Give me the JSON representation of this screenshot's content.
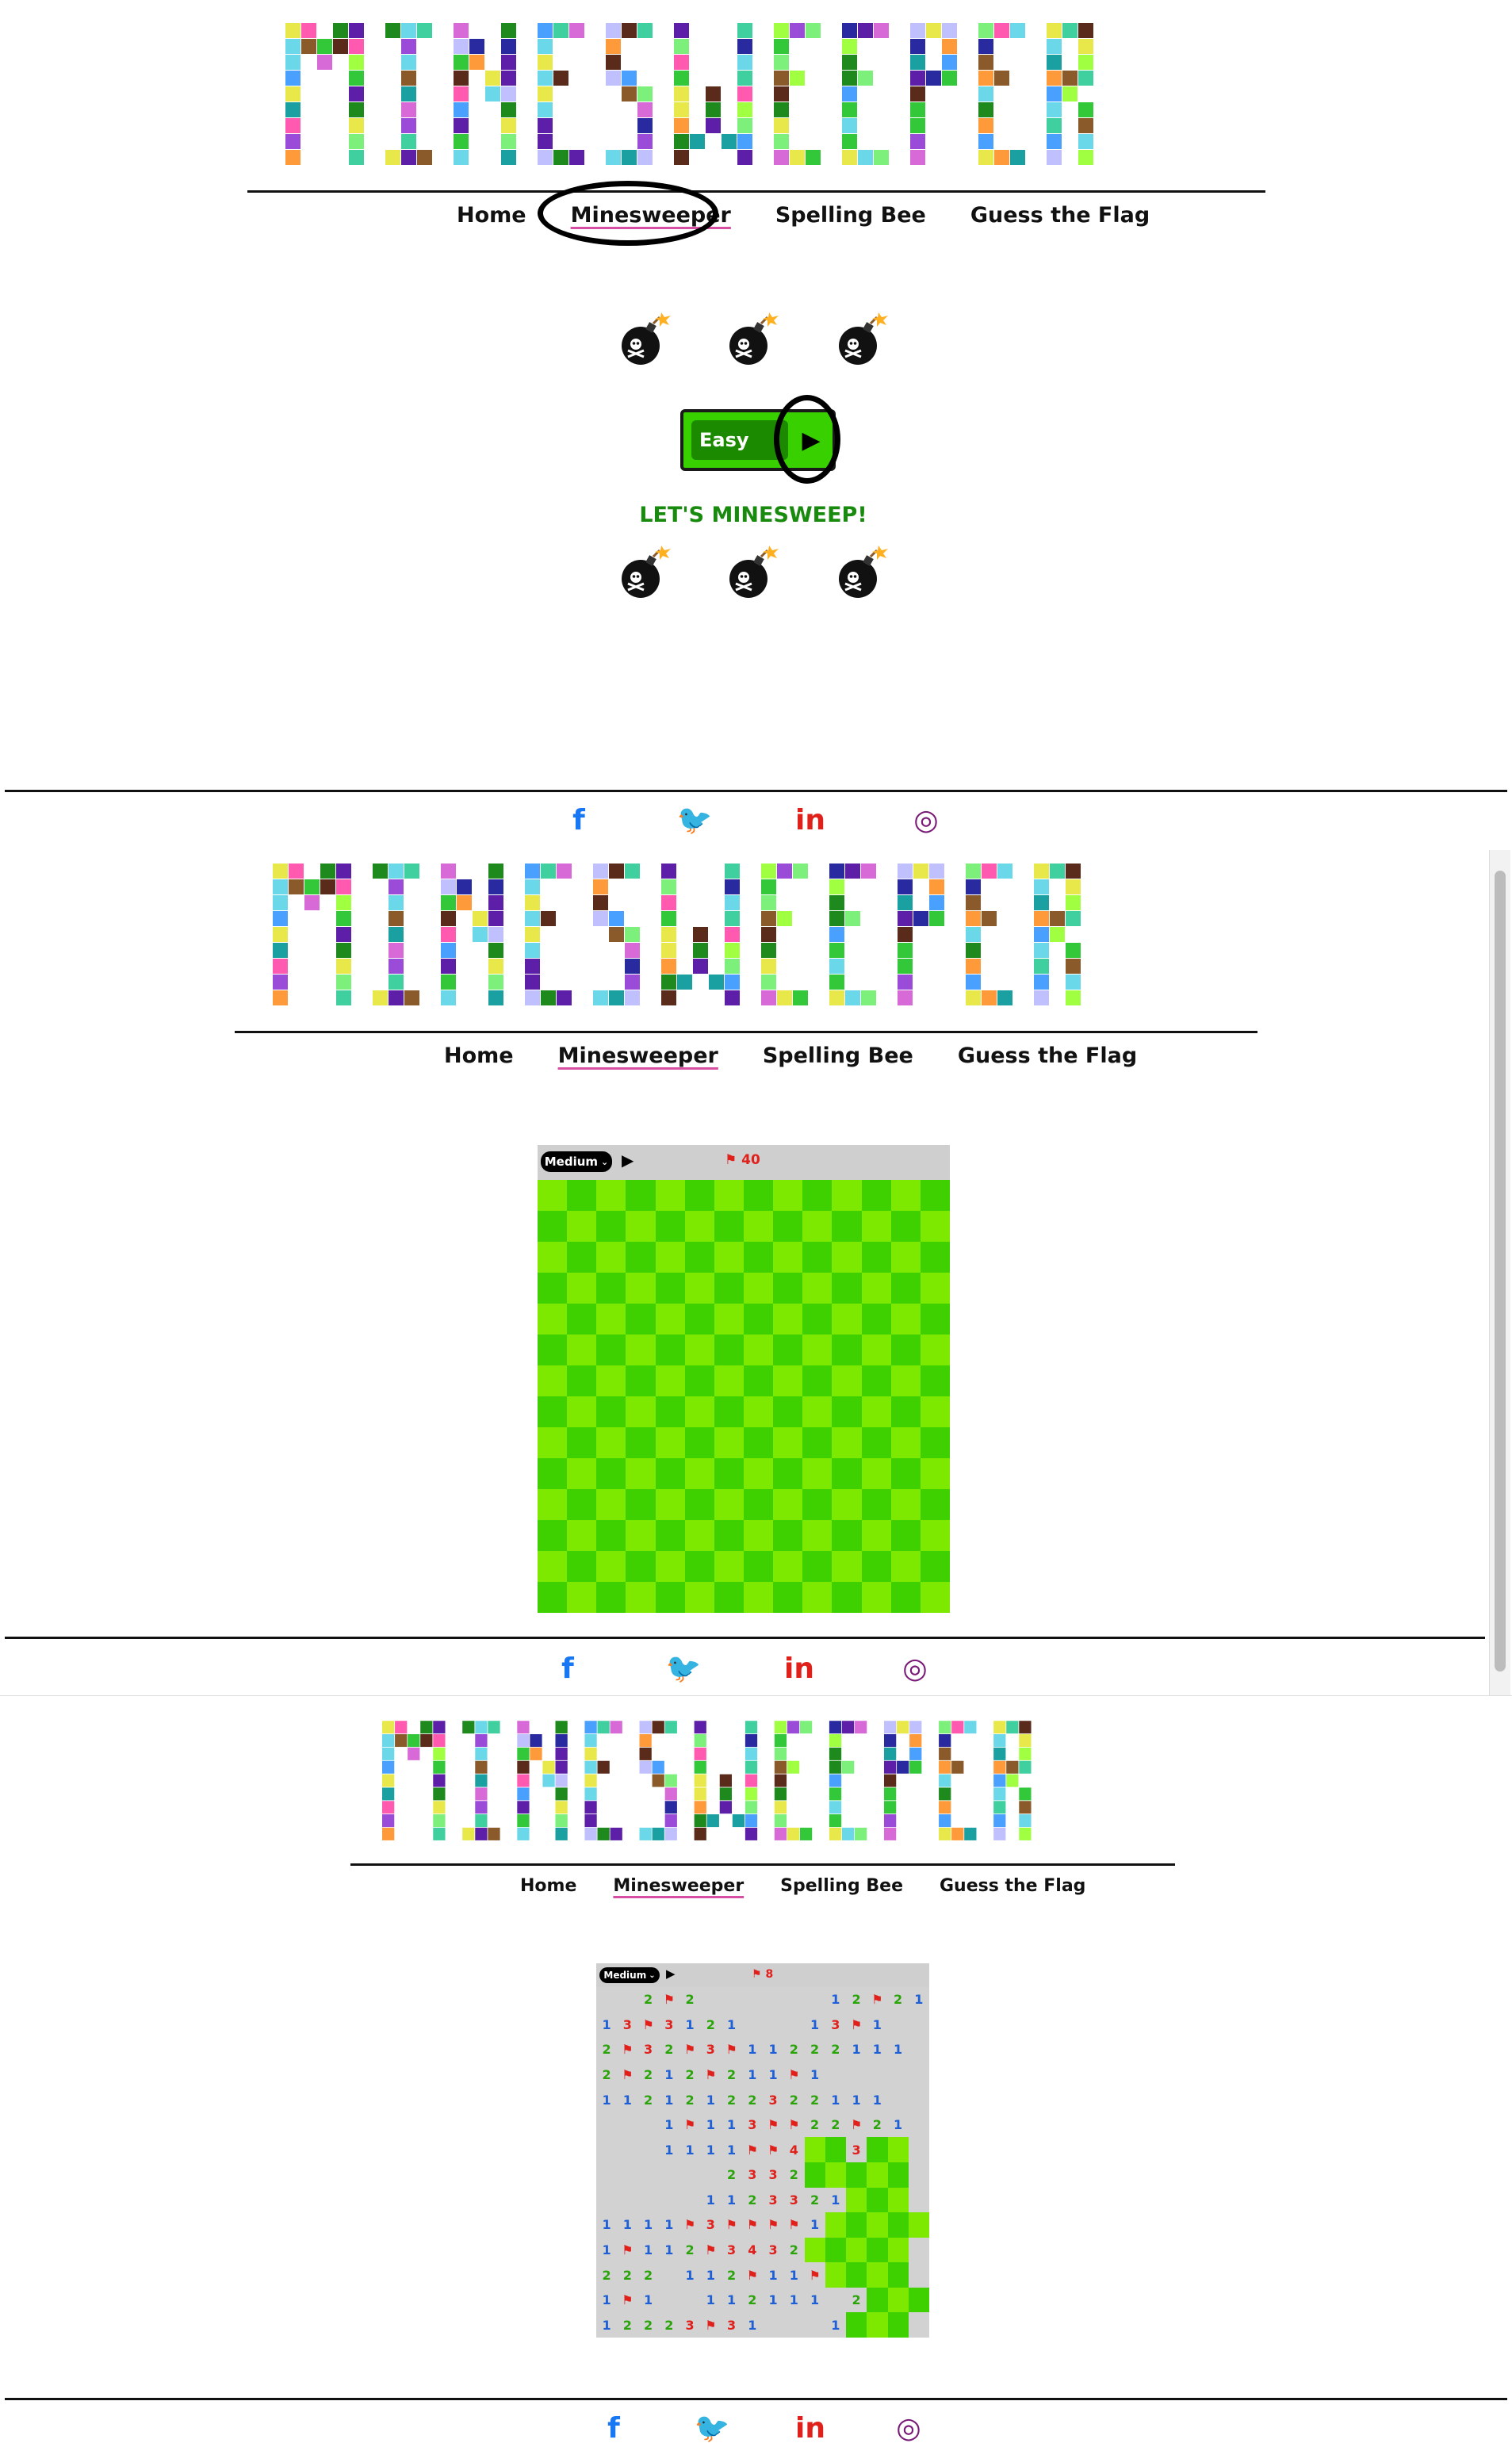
{
  "site": {
    "logo_text": "MINESWEEPER",
    "nav": [
      {
        "label": "Home",
        "active": false
      },
      {
        "label": "Minesweeper",
        "active": true
      },
      {
        "label": "Spelling Bee",
        "active": false
      },
      {
        "label": "Guess the Flag",
        "active": false
      }
    ],
    "social": [
      {
        "name": "facebook-icon",
        "glyph": "f",
        "color": "#1877f2"
      },
      {
        "name": "twitter-icon",
        "glyph": "🐦",
        "color": "#35c619"
      },
      {
        "name": "linkedin-icon",
        "glyph": "in",
        "color": "#e0201b"
      },
      {
        "name": "instagram-icon",
        "glyph": "◎",
        "color": "#7a1a78"
      }
    ]
  },
  "start_screen": {
    "difficulty_label": "Easy",
    "play_icon": "▶",
    "tagline": "LET'S MINESWEEP!"
  },
  "board_empty": {
    "level": "Medium",
    "flags": "40",
    "rows": 14,
    "cols": 14,
    "colors": {
      "light": "#7de800",
      "dark": "#3fd000"
    }
  },
  "board_played": {
    "level": "Medium",
    "flags": "8",
    "rows": [
      "..2F2......12F21",
      "13F3121...13F1",
      "2F32F3F11222111",
      "2F212F211F1",
      "11212122322111",
      "...1F113FF22F21",
      "...1111FF4##3##",
      "......2332#####",
      ".....1123321###",
      "1111F3FFFF1#####",
      "1F112F3432#####",
      "222.112F11F####",
      "1F1..112111 2###",
      "12223F31...1###"
    ]
  },
  "colors": {
    "one": "#1e5fd6",
    "two": "#2aa40a",
    "three": "#e0201b",
    "flag": "#e0201b",
    "revealed": "#d2d2d2"
  }
}
